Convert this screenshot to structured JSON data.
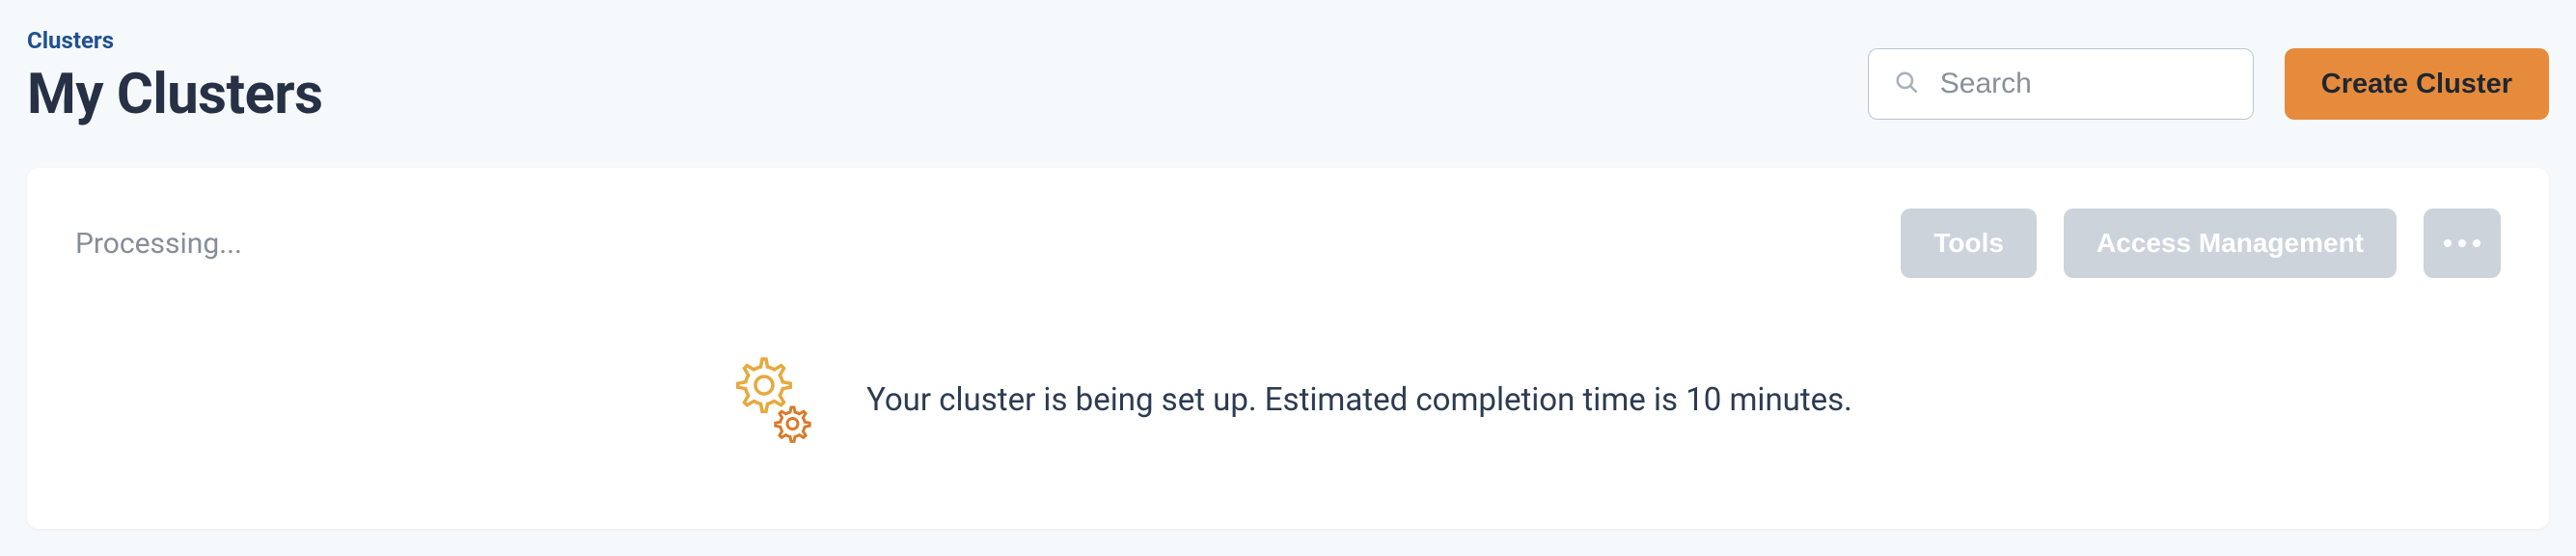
{
  "breadcrumb": "Clusters",
  "page_title": "My Clusters",
  "search": {
    "placeholder": "Search"
  },
  "create_button": "Create Cluster",
  "card": {
    "status": "Processing...",
    "tools_label": "Tools",
    "access_label": "Access Management",
    "message": "Your cluster is being set up. Estimated completion time is 10 minutes."
  }
}
